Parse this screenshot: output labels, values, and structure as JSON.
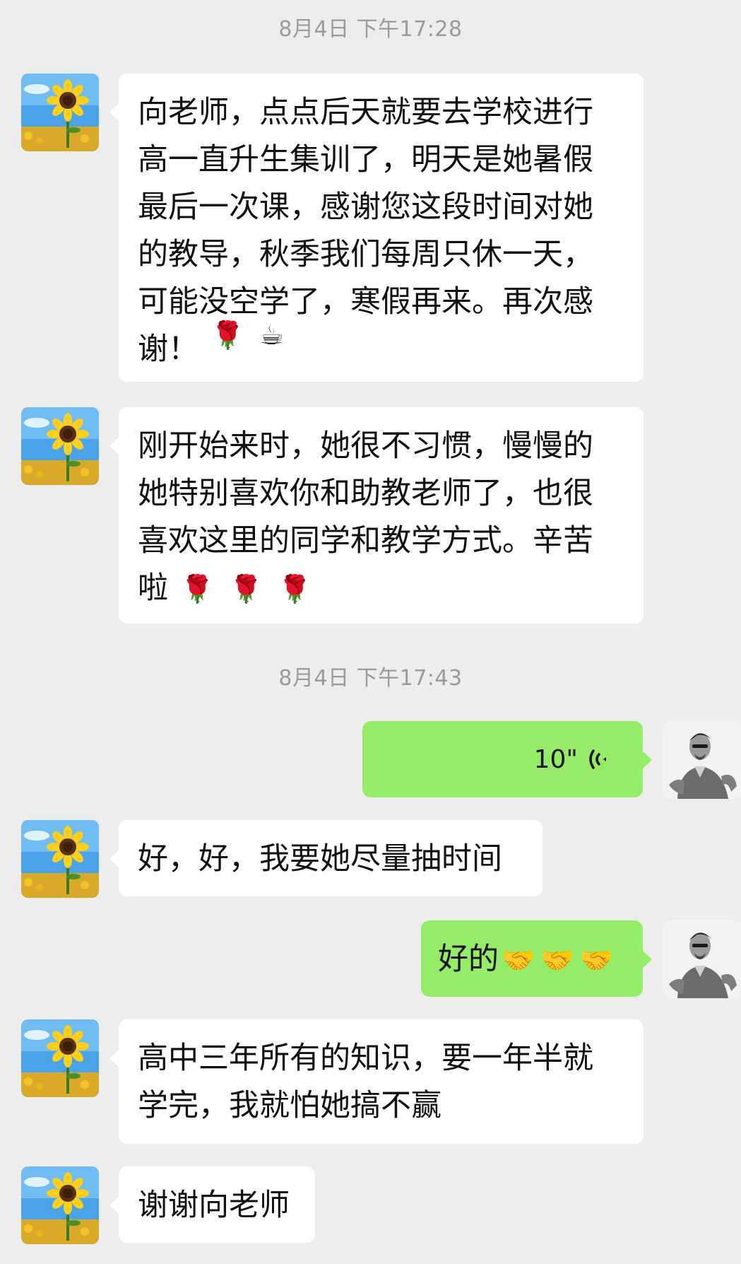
{
  "chat": {
    "timestamps": [
      "8月4日 下午17:28",
      "8月4日 下午17:43"
    ],
    "messages": [
      {
        "from": "other",
        "text": "向老师，点点后天就要去学校进行\n高一直升生集训了，明天是她暑假\n最后一次课，感谢您这段时间对她\n的教导，秋季我们每周只休一天，\n可能没空学了，寒假再来。再次感\n谢！",
        "emoji": [
          "🌹",
          "☕"
        ]
      },
      {
        "from": "other",
        "text": "刚开始来时，她很不习惯，慢慢的\n她特别喜欢你和助教老师了，也很\n喜欢这里的同学和教学方式。辛苦\n啦",
        "emoji": [
          "🌹",
          "🌹",
          "🌹"
        ]
      },
      {
        "from": "me",
        "type": "voice",
        "duration": "10\""
      },
      {
        "from": "other",
        "text": "好，好，我要她尽量抽时间"
      },
      {
        "from": "me",
        "text": "好的",
        "emoji": [
          "🤝",
          "🤝",
          "🤝"
        ]
      },
      {
        "from": "other",
        "text": "高中三年所有的知识，要一年半就\n学完，我就怕她搞不赢"
      },
      {
        "from": "other",
        "text": "谢谢向老师"
      }
    ]
  },
  "colors": {
    "background": "#ededed",
    "incoming_bubble": "#ffffff",
    "outgoing_bubble": "#95ec69",
    "timestamp": "#9a9a9a"
  },
  "icons": {
    "voice": "voice-wave-icon",
    "other_avatar": "sunflower-avatar",
    "my_avatar": "man-avatar"
  }
}
